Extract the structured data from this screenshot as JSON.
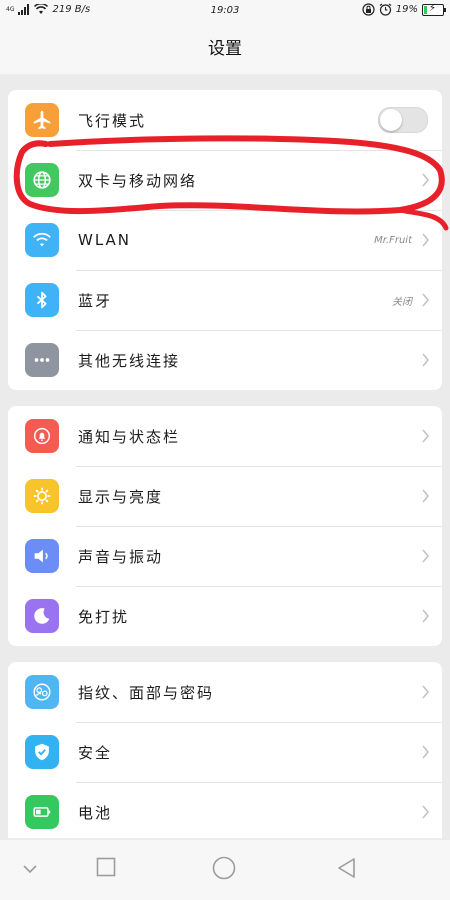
{
  "status_bar": {
    "network_type": "4G",
    "speed": "219 B/s",
    "time": "19:03",
    "battery_percent": "19%",
    "battery_level": 0.19,
    "icons": [
      "signal-icon",
      "wifi-icon",
      "lock-rotation-icon",
      "alarm-icon",
      "battery-charging-icon"
    ]
  },
  "header": {
    "title": "设置"
  },
  "colors": {
    "airplane": "#f7a03a",
    "mobile_network": "#43c75f",
    "wlan": "#3fb3f5",
    "bluetooth": "#3fb3f5",
    "other_wireless": "#8e95a0",
    "notifications": "#f45c52",
    "display": "#f7c52b",
    "sound": "#6b8df5",
    "dnd": "#9a73f0",
    "fingerprint": "#4fb6f2",
    "security": "#33b2f2",
    "battery": "#35c85e",
    "annotation_red": "#e8202a"
  },
  "groups": [
    {
      "items": [
        {
          "label": "飞行模式",
          "icon": "airplane-icon",
          "control": "toggle",
          "toggle_on": false
        },
        {
          "label": "双卡与移动网络",
          "icon": "globe-icon",
          "control": "chevron"
        },
        {
          "label": "WLAN",
          "icon": "wifi-icon",
          "value": "Mr.Fruit",
          "control": "chevron"
        },
        {
          "label": "蓝牙",
          "icon": "bluetooth-icon",
          "value": "关闭",
          "control": "chevron"
        },
        {
          "label": "其他无线连接",
          "icon": "more-dots-icon",
          "control": "chevron"
        }
      ]
    },
    {
      "items": [
        {
          "label": "通知与状态栏",
          "icon": "bell-icon",
          "control": "chevron"
        },
        {
          "label": "显示与亮度",
          "icon": "sun-icon",
          "control": "chevron"
        },
        {
          "label": "声音与振动",
          "icon": "speaker-icon",
          "control": "chevron"
        },
        {
          "label": "免打扰",
          "icon": "moon-icon",
          "control": "chevron"
        }
      ]
    },
    {
      "items": [
        {
          "label": "指纹、面部与密码",
          "icon": "fingerprint-face-icon",
          "control": "chevron"
        },
        {
          "label": "安全",
          "icon": "shield-check-icon",
          "control": "chevron"
        },
        {
          "label": "电池",
          "icon": "battery-icon",
          "control": "chevron"
        }
      ]
    }
  ],
  "nav_bar": {
    "buttons": [
      "chevron-down-icon",
      "recent-apps-icon",
      "home-icon",
      "back-icon"
    ]
  }
}
